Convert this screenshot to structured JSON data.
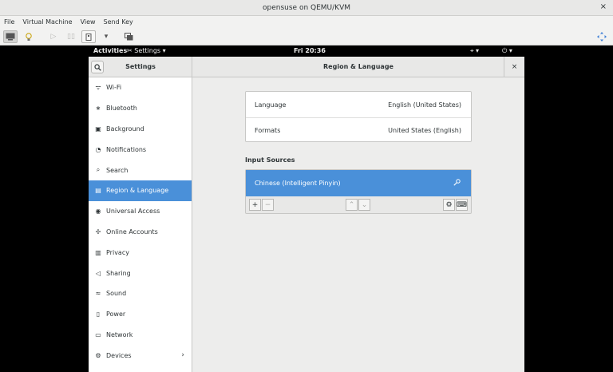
{
  "window": {
    "title": "opensuse on QEMU/KVM",
    "close_glyph": "×"
  },
  "menubar": {
    "items": [
      "File",
      "Virtual Machine",
      "View",
      "Send Key"
    ]
  },
  "toolbar": {
    "icons": [
      "console-icon",
      "details-icon",
      "run-icon",
      "pause-icon",
      "shutdown-icon",
      "dropdown-icon",
      "snapshots-icon",
      "fullscreen-icon"
    ]
  },
  "gnome_topbar": {
    "activities": "Activities",
    "app_menu": "Settings ▾",
    "clock": "Fri 20:36",
    "network": "⌖ ▾",
    "power": "⏻ ▾"
  },
  "settings": {
    "sidebar_title": "Settings",
    "panel_title": "Region & Language",
    "close_glyph": "×",
    "sidebar_items": [
      {
        "label": "Wi-Fi",
        "icon": "wifi-icon",
        "glyph": "ᯤ"
      },
      {
        "label": "Bluetooth",
        "icon": "bluetooth-icon",
        "glyph": "∗"
      },
      {
        "label": "Background",
        "icon": "background-icon",
        "glyph": "▣"
      },
      {
        "label": "Notifications",
        "icon": "notifications-icon",
        "glyph": "◔"
      },
      {
        "label": "Search",
        "icon": "search-icon",
        "glyph": "⌕"
      },
      {
        "label": "Region & Language",
        "icon": "region-icon",
        "glyph": "▤",
        "active": true
      },
      {
        "label": "Universal Access",
        "icon": "universal-access-icon",
        "glyph": "◉"
      },
      {
        "label": "Online Accounts",
        "icon": "online-accounts-icon",
        "glyph": "✢"
      },
      {
        "label": "Privacy",
        "icon": "privacy-icon",
        "glyph": "▥"
      },
      {
        "label": "Sharing",
        "icon": "sharing-icon",
        "glyph": "◁"
      },
      {
        "label": "Sound",
        "icon": "sound-icon",
        "glyph": "≈"
      },
      {
        "label": "Power",
        "icon": "power-icon",
        "glyph": "▯"
      },
      {
        "label": "Network",
        "icon": "network-icon",
        "glyph": "▭"
      },
      {
        "label": "Devices",
        "icon": "devices-icon",
        "glyph": "⚙",
        "arrow": "›"
      }
    ],
    "language_label": "Language",
    "language_value": "English (United States)",
    "formats_label": "Formats",
    "formats_value": "United States (English)",
    "input_sources_title": "Input Sources",
    "input_source": "Chinese (Intelligent Pinyin)",
    "buttons": {
      "add": "+",
      "remove": "−",
      "up": "⌃",
      "down": "⌄",
      "settings": "⚙",
      "keyboard": "⌨"
    }
  },
  "colors": {
    "selection": "#4a90d9",
    "topbar": "#000000"
  }
}
